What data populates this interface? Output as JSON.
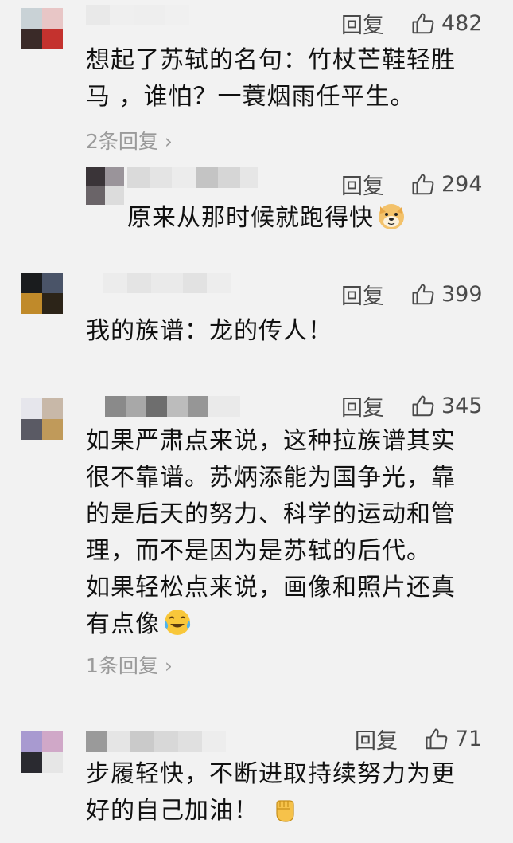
{
  "comments": [
    {
      "reply_label": "回复",
      "likes": "482",
      "lines": [
        "想起了苏轼的名句：竹杖芒鞋轻胜",
        "马 ，谁怕？一蓑烟雨任平生。"
      ],
      "more_replies": "2条回复",
      "avatar_colors": [
        "#c9d2d6",
        "#e8c6c6",
        "#3a2a28",
        "#c4322e"
      ],
      "name_colors": [
        "#c8c8c8",
        "#d8d8d8",
        "#cfcfcf",
        "#dcdcdc",
        "#e2e2e2",
        "#d5d5d5"
      ]
    },
    {
      "reply_label": "回复",
      "likes": "294",
      "lines": [
        "原来从那时候就跑得快"
      ],
      "emoji": "doge-emoji",
      "avatar_colors": [
        "#3a3438",
        "#9a949a",
        "#6a6468",
        "#dcdcdc"
      ],
      "name_colors": [
        "#d6d6d6",
        "#c9c9c9",
        "#e0e0e0",
        "#bcbcbc",
        "#d0d0d0",
        "#9a9a9a"
      ]
    },
    {
      "reply_label": "回复",
      "likes": "399",
      "lines": [
        "我的族谱：龙的传人！"
      ],
      "avatar_colors": [
        "#1a1c1e",
        "#4a5468",
        "#c08a2a",
        "#2c2418"
      ],
      "name_colors": [
        "#d2d2d2",
        "#dadada",
        "#cccccc",
        "#d6d6d6",
        "#e2e2e2",
        "#c6c6c6"
      ]
    },
    {
      "reply_label": "回复",
      "likes": "345",
      "lines": [
        "如果严肃点来说，这种拉族谱其实",
        "很不靠谱。苏炳添能为国争光，靠",
        "的是后天的努力、科学的运动和管",
        "理，而不是因为是苏轼的后代。",
        "如果轻松点来说，画像和照片还真",
        "有点像"
      ],
      "emoji": "laugh-cry-emoji",
      "more_replies": "1条回复",
      "avatar_colors": [
        "#e6e6ec",
        "#c8b8a8",
        "#5a5a64",
        "#c09a5a"
      ],
      "name_colors": [
        "#8a8a8a",
        "#a8a8a8",
        "#6e6e6e",
        "#bcbcbc",
        "#969696",
        "#d0d0d0"
      ]
    },
    {
      "reply_label": "回复",
      "likes": "71",
      "lines": [
        "步履轻快，不断进取持续努力为更",
        "好的自己加油！"
      ],
      "emoji": "fist-emoji",
      "avatar_colors": [
        "#a89ad0",
        "#d0a8c8",
        "#2a2a30",
        "#e6e6e6"
      ],
      "name_colors": [
        "#9a9a9a",
        "#c6c6c6",
        "#b0b0b0",
        "#d8d8d8",
        "#cacaca",
        "#e0e0e0"
      ]
    }
  ],
  "colors": {
    "background": "#f2f2f2",
    "action_gray": "#4a4a4a",
    "secondary_gray": "#9a9a9a",
    "text": "#111111"
  }
}
